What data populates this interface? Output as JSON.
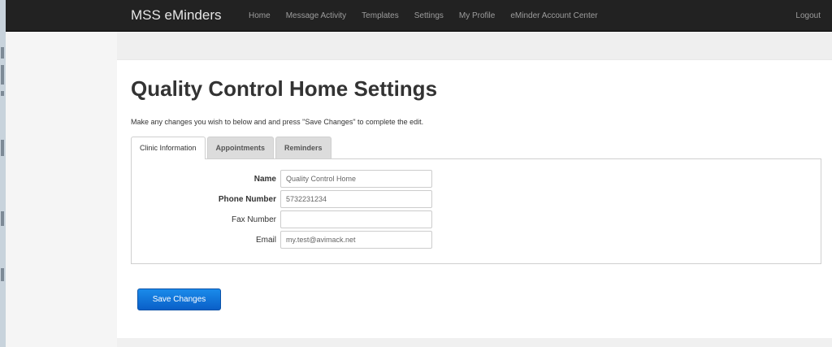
{
  "navbar": {
    "brand": "MSS eMinders",
    "links": [
      "Home",
      "Message Activity",
      "Templates",
      "Settings",
      "My Profile",
      "eMinder Account Center"
    ],
    "logout": "Logout"
  },
  "page": {
    "title": "Quality Control Home Settings",
    "instructions": "Make any changes you wish to below and and press \"Save Changes\" to complete the edit."
  },
  "tabs": {
    "items": [
      "Clinic Information",
      "Appointments",
      "Reminders"
    ],
    "active": "Clinic Information"
  },
  "form": {
    "fields": [
      {
        "label": "Name",
        "value": "Quality Control Home",
        "required": true
      },
      {
        "label": "Phone Number",
        "value": "5732231234",
        "required": true
      },
      {
        "label": "Fax Number",
        "value": "",
        "required": false
      },
      {
        "label": "Email",
        "value": "my.test@avimack.net",
        "required": false
      }
    ]
  },
  "actions": {
    "save_label": "Save Changes"
  },
  "colors": {
    "navbar_bg": "#222222",
    "primary_button": "#0a6fd6"
  }
}
